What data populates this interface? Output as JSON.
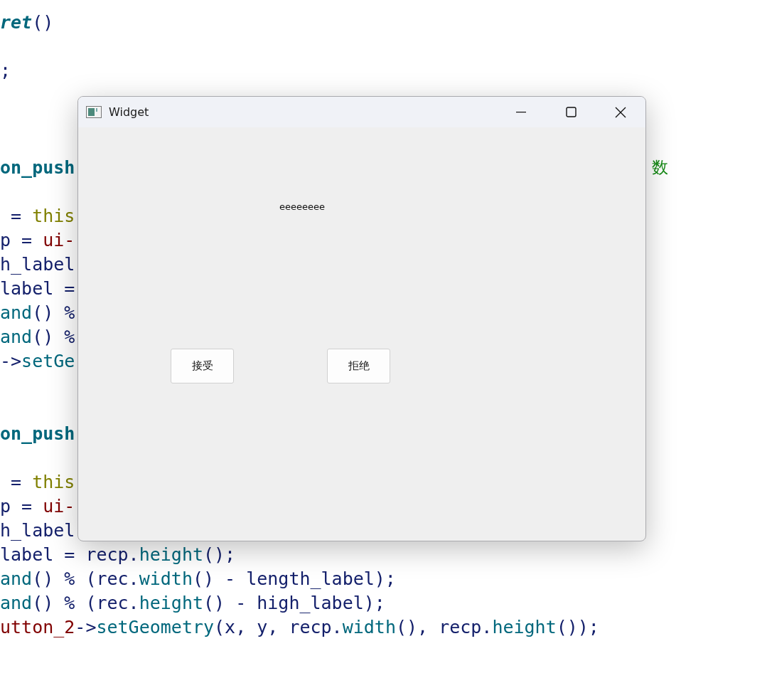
{
  "editor": {
    "lines": [
      {
        "tokens": [
          {
            "kind": "name-italic",
            "text": "ret"
          },
          {
            "kind": "plain",
            "text": "()"
          }
        ]
      },
      {
        "tokens": [
          {
            "kind": "plain",
            "text": ";"
          }
        ]
      },
      {
        "tokens": [
          {
            "kind": "name-bold",
            "text": "on_push"
          }
        ],
        "comment": "数"
      },
      {
        "tokens": [
          {
            "kind": "plain",
            "text": " = "
          },
          {
            "kind": "keyword",
            "text": "this"
          }
        ]
      },
      {
        "tokens": [
          {
            "kind": "plain",
            "text": "p = "
          },
          {
            "kind": "member",
            "text": "ui-"
          }
        ]
      },
      {
        "tokens": [
          {
            "kind": "plain",
            "text": "h_label"
          }
        ]
      },
      {
        "tokens": [
          {
            "kind": "plain",
            "text": "label ="
          }
        ]
      },
      {
        "tokens": [
          {
            "kind": "function",
            "text": "and"
          },
          {
            "kind": "plain",
            "text": "() %"
          }
        ]
      },
      {
        "tokens": [
          {
            "kind": "function",
            "text": "and"
          },
          {
            "kind": "plain",
            "text": "() %"
          }
        ]
      },
      {
        "tokens": [
          {
            "kind": "plain",
            "text": "->"
          },
          {
            "kind": "function",
            "text": "setGe"
          }
        ]
      },
      {
        "tokens": [
          {
            "kind": "name-bold",
            "text": "on_push"
          }
        ]
      },
      {
        "tokens": [
          {
            "kind": "plain",
            "text": " = "
          },
          {
            "kind": "keyword",
            "text": "this"
          }
        ]
      },
      {
        "tokens": [
          {
            "kind": "plain",
            "text": "p = "
          },
          {
            "kind": "member",
            "text": "ui-"
          }
        ]
      },
      {
        "tokens": [
          {
            "kind": "plain",
            "text": "h_label"
          }
        ]
      },
      {
        "tokens": [
          {
            "kind": "plain",
            "text": "label = recp."
          },
          {
            "kind": "function",
            "text": "height"
          },
          {
            "kind": "plain",
            "text": "();"
          }
        ]
      },
      {
        "tokens": [
          {
            "kind": "function",
            "text": "and"
          },
          {
            "kind": "plain",
            "text": "() % (rec."
          },
          {
            "kind": "function",
            "text": "width"
          },
          {
            "kind": "plain",
            "text": "() - length_label);"
          }
        ]
      },
      {
        "tokens": [
          {
            "kind": "function",
            "text": "and"
          },
          {
            "kind": "plain",
            "text": "() % (rec."
          },
          {
            "kind": "function",
            "text": "height"
          },
          {
            "kind": "plain",
            "text": "() - high_label);"
          }
        ]
      },
      {
        "tokens": [
          {
            "kind": "member",
            "text": "utton_2"
          },
          {
            "kind": "plain",
            "text": "->"
          },
          {
            "kind": "function",
            "text": "setGeometry"
          },
          {
            "kind": "plain",
            "text": "(x, y, recp."
          },
          {
            "kind": "function",
            "text": "width"
          },
          {
            "kind": "plain",
            "text": "(), recp."
          },
          {
            "kind": "function",
            "text": "height"
          },
          {
            "kind": "plain",
            "text": "());"
          }
        ]
      }
    ]
  },
  "window": {
    "title": "Widget",
    "label": "eeeeeeee",
    "buttons": [
      "接受",
      "拒绝"
    ]
  }
}
